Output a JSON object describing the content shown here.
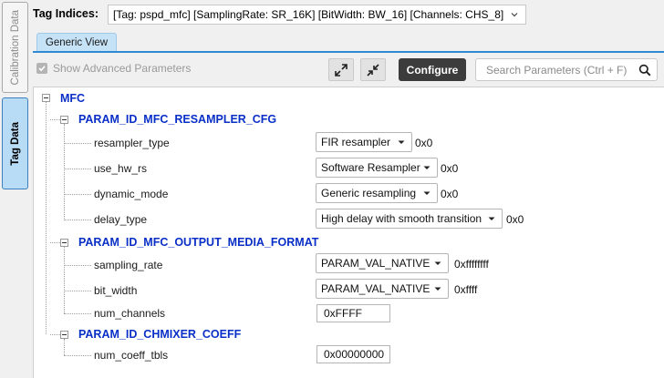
{
  "sidebar": {
    "tabs": [
      {
        "label": "Calibration Data",
        "active": false
      },
      {
        "label": "Tag Data",
        "active": true
      }
    ]
  },
  "header": {
    "tag_label": "Tag Indices:",
    "tag_value": "[Tag: pspd_mfc] [SamplingRate: SR_16K] [BitWidth: BW_16] [Channels: CHS_8]"
  },
  "tabs": [
    {
      "label": "Generic View",
      "active": true
    }
  ],
  "toolbar": {
    "show_advanced_label": "Show Advanced Parameters",
    "show_advanced_checked": true,
    "configure_label": "Configure",
    "search_placeholder": "Search Parameters (Ctrl + F)"
  },
  "tree": {
    "root": "MFC",
    "groups": [
      {
        "name": "PARAM_ID_MFC_RESAMPLER_CFG",
        "params": [
          {
            "name": "resampler_type",
            "value": "FIR resampler",
            "hex": "0x0"
          },
          {
            "name": "use_hw_rs",
            "value": "Software Resampler",
            "hex": "0x0"
          },
          {
            "name": "dynamic_mode",
            "value": "Generic resampling",
            "hex": "0x0"
          },
          {
            "name": "delay_type",
            "value": "High delay with smooth transition",
            "hex": "0x0"
          }
        ]
      },
      {
        "name": "PARAM_ID_MFC_OUTPUT_MEDIA_FORMAT",
        "params": [
          {
            "name": "sampling_rate",
            "value": "PARAM_VAL_NATIVE",
            "hex": "0xffffffff"
          },
          {
            "name": "bit_width",
            "value": "PARAM_VAL_NATIVE",
            "hex": "0xffff"
          },
          {
            "name": "num_channels",
            "value": "0xFFFF"
          }
        ]
      },
      {
        "name": "PARAM_ID_CHMIXER_COEFF",
        "params": [
          {
            "name": "num_coeff_tbls",
            "value": "0x00000000"
          }
        ]
      }
    ]
  },
  "colors": {
    "accent_blue": "#2f89d2",
    "node_text": "#0a2fc7",
    "configure_bg": "#3c3c3c",
    "active_tab_bg": "#b9dcf6"
  }
}
